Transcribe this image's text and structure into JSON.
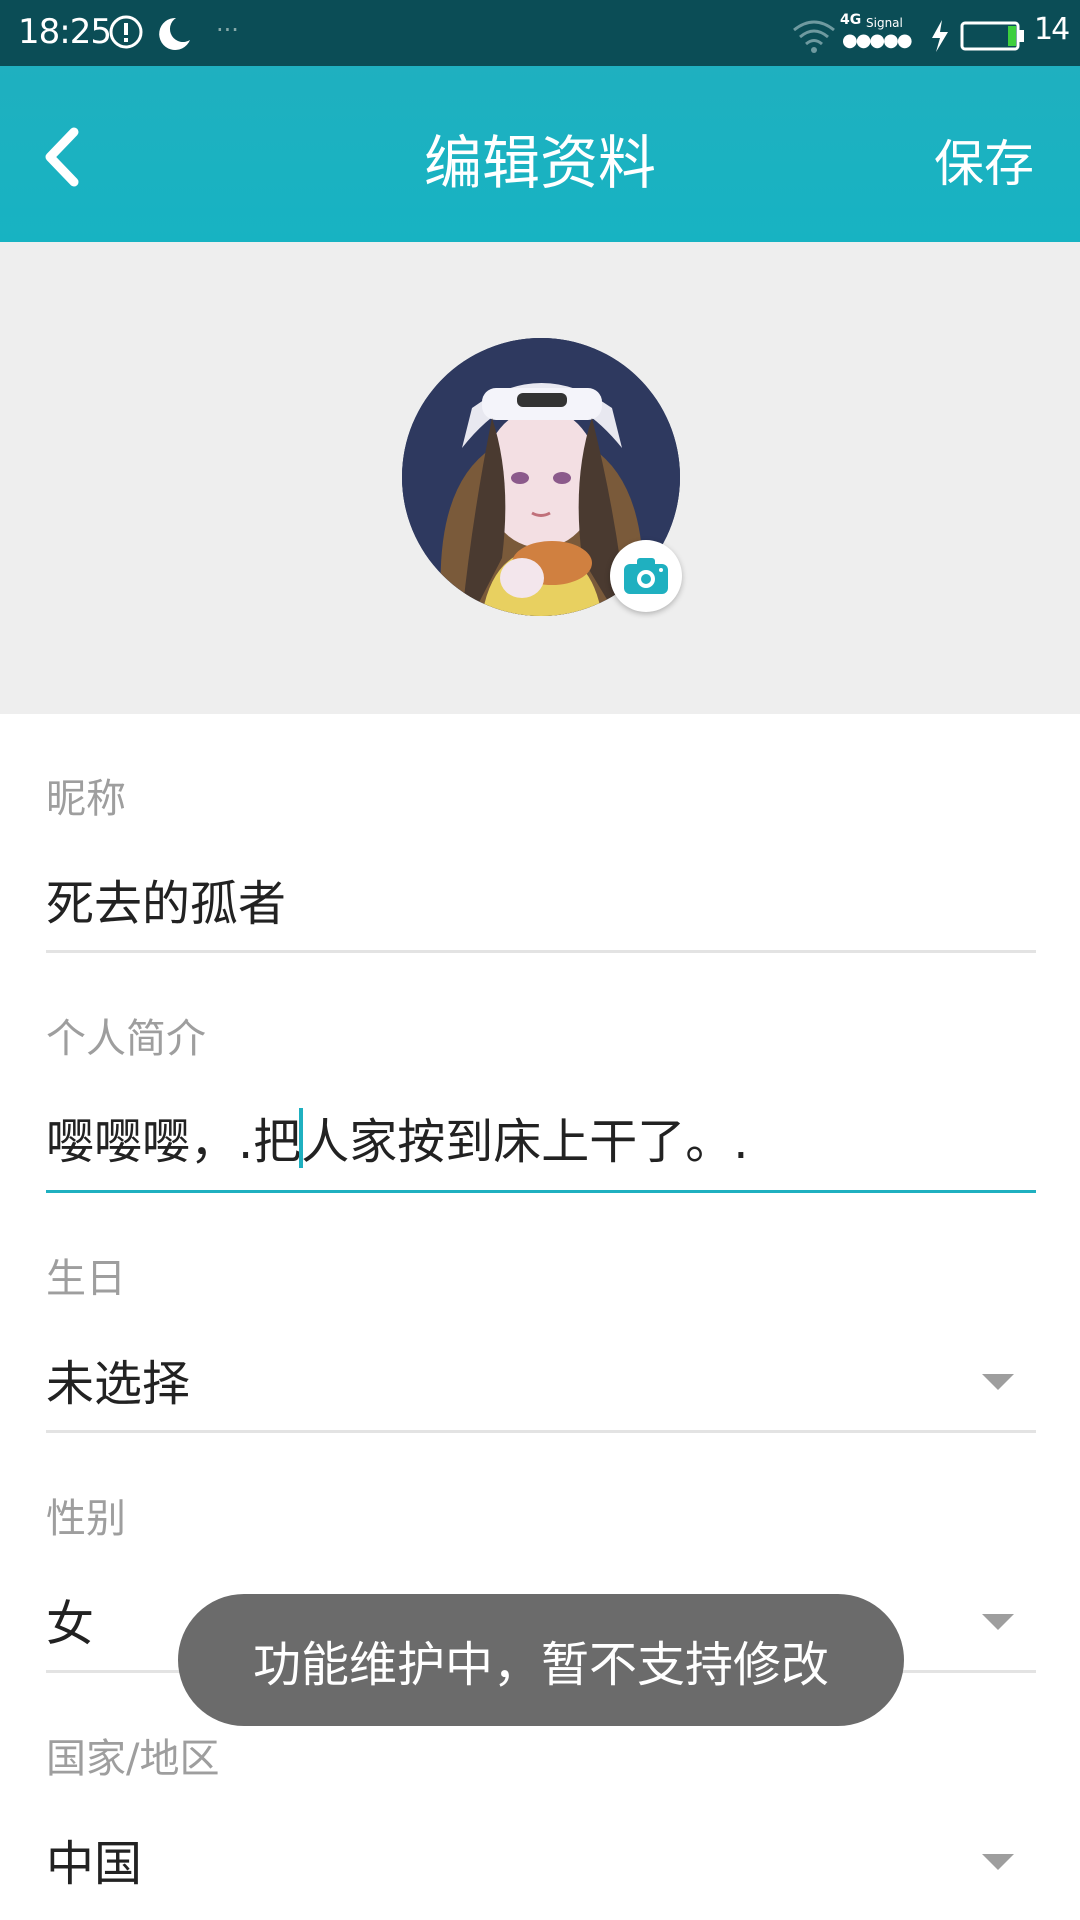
{
  "status_bar": {
    "time": "18:25",
    "network_type": "4G",
    "signal_label": "Signal",
    "signal_dots": "●●●●●",
    "battery_level": "14",
    "dots": "···"
  },
  "header": {
    "title": "编辑资料",
    "save_label": "保存"
  },
  "form": {
    "nickname": {
      "label": "昵称",
      "value": "死去的孤者"
    },
    "bio": {
      "label": "个人简介",
      "value_before_cursor": "嘤嘤嘤，.把",
      "value_after_cursor": "人家按到床上干了。."
    },
    "birthday": {
      "label": "生日",
      "value": "未选择"
    },
    "gender": {
      "label": "性别",
      "value": "女"
    },
    "region": {
      "label": "国家/地区",
      "value": "中国"
    }
  },
  "toast": {
    "text": "功能维护中，暂不支持修改"
  },
  "colors": {
    "accent": "#1fb0c0",
    "status_bar": "#0b4d56",
    "toast": "#6b6b6b"
  }
}
